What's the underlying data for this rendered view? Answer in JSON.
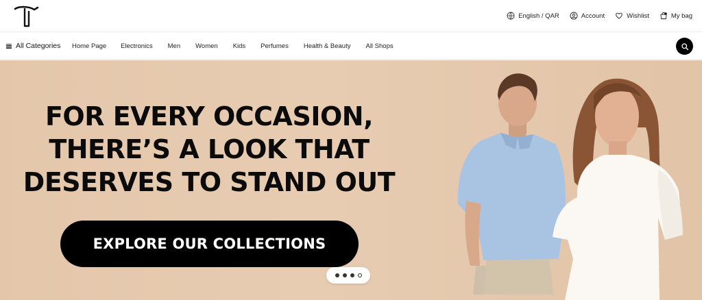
{
  "header": {
    "language": "English / QAR",
    "account": "Account",
    "wishlist": "Wishlist",
    "bag": "My bag"
  },
  "nav": {
    "all_categories": "All Categories",
    "items": [
      "Home Page",
      "Electronics",
      "Men",
      "Women",
      "Kids",
      "Perfumes",
      "Health & Beauty",
      "All Shops"
    ]
  },
  "hero": {
    "headline_lines": [
      "FOR EVERY OCCASION,",
      "THERE’S A LOOK THAT",
      "DESERVES TO STAND OUT"
    ],
    "cta": "EXPLORE OUR COLLECTIONS",
    "carousel": {
      "slides": 4,
      "active_index": 3
    }
  },
  "colors": {
    "hero_background": "#e6c9ae",
    "cta_background": "#000000",
    "cta_text": "#ffffff",
    "search_button": "#000000"
  },
  "icons": {
    "logo": "brand-logo",
    "language": "globe-icon",
    "account": "user-icon",
    "wishlist": "heart-icon",
    "bag": "bag-icon",
    "search": "search-icon",
    "categories": "menu-icon"
  }
}
